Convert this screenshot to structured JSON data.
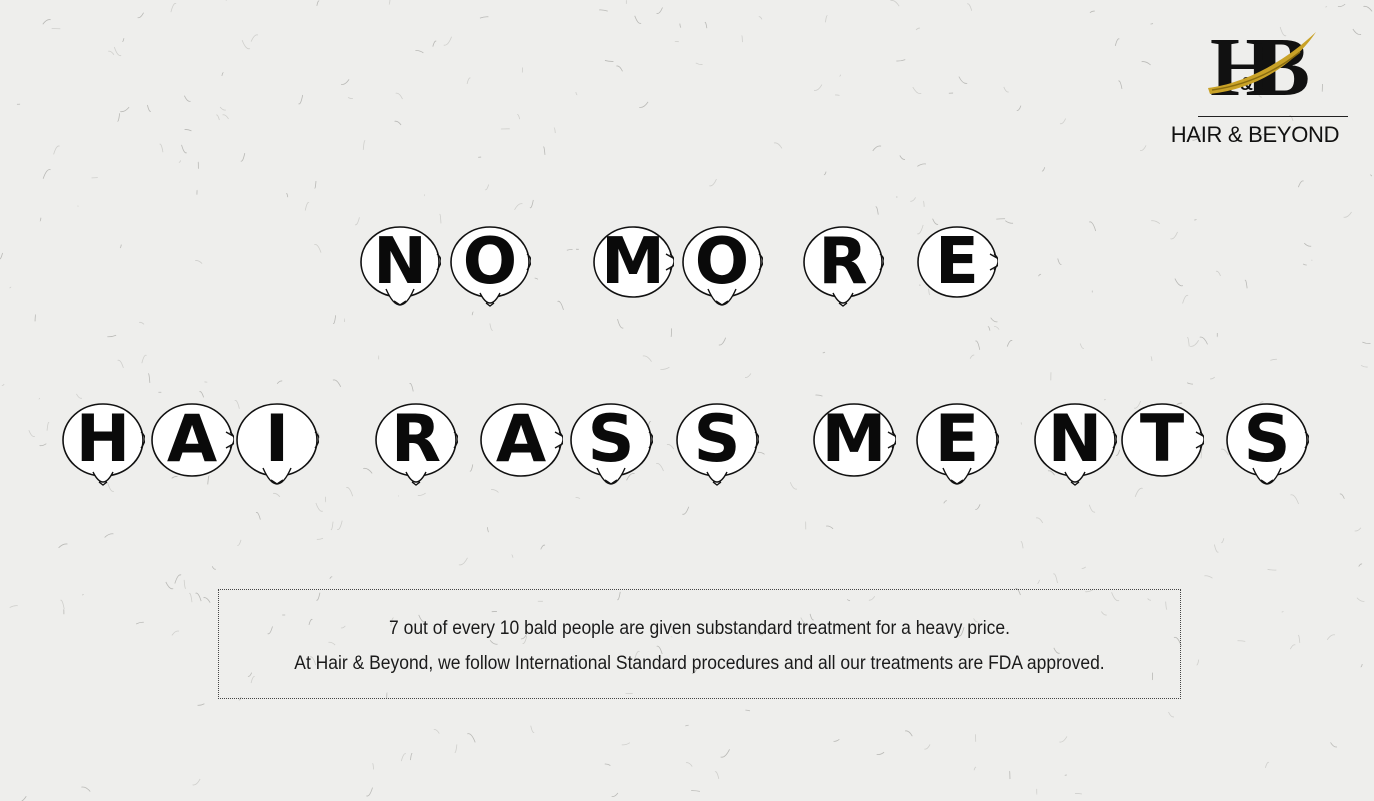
{
  "brand": {
    "monogram_h": "H",
    "monogram_amp": "&",
    "monogram_b": "B",
    "name": "HAIR & BEYOND",
    "accent_color": "#c9a227"
  },
  "headline": {
    "line1": [
      "N",
      "O",
      "M",
      "O",
      "R",
      "E"
    ],
    "line2": [
      "H",
      "A",
      "I",
      "R",
      "A",
      "S",
      "S",
      "M",
      "E",
      "N",
      "T",
      "S"
    ]
  },
  "info": {
    "line1": "7 out of every 10 bald people are given substandard treatment for a heavy price.",
    "line2": "At Hair & Beyond, we follow International Standard procedures and all our treatments are FDA approved."
  }
}
